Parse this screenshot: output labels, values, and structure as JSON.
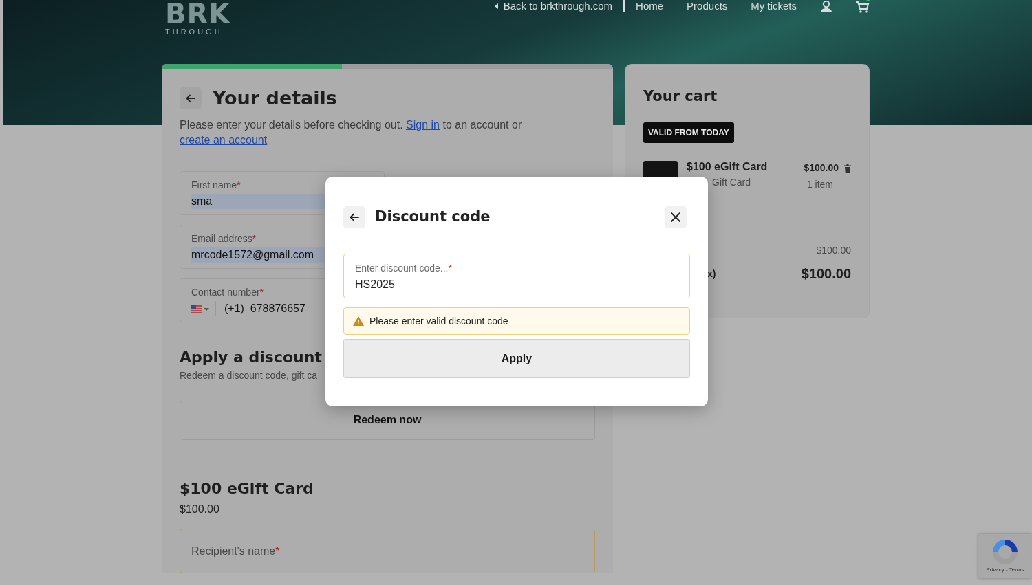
{
  "header": {
    "logo": {
      "text": "BRK",
      "subtext": "THROUGH"
    },
    "back_link": "Back to brkthrough.com",
    "nav": [
      {
        "label": "Home"
      },
      {
        "label": "Products"
      },
      {
        "label": "My tickets"
      }
    ]
  },
  "details": {
    "progress": {
      "level": 0.4
    },
    "title": "Your details",
    "intro": [
      {
        "kind": "text",
        "text": "Please enter your details before checking out. "
      },
      {
        "kind": "link",
        "text": "Sign in"
      },
      {
        "kind": "text",
        "text": " to an account or "
      },
      {
        "kind": "link",
        "text": "create an account"
      }
    ],
    "fields": [
      {
        "kind": "text",
        "label": "First name",
        "required_mark": "*",
        "value": "sma",
        "autofilled": true
      },
      {
        "kind": "text",
        "label": "Email address",
        "required_mark": "*",
        "value": "mrcode1572@gmail.com",
        "autofilled": true
      },
      {
        "kind": "phone",
        "label": "Contact number",
        "required_mark": "*",
        "prefix": "(+1)",
        "value": "678876657",
        "autofilled": false
      }
    ],
    "discount": {
      "title": "Apply a discount",
      "subtitle": "Redeem a discount code, gift ca",
      "button": "Redeem now"
    },
    "product": {
      "title": "$100 eGift Card",
      "price": "$100.00",
      "fields": [
        {
          "label": "Recipient's name",
          "required_mark": "*"
        }
      ]
    }
  },
  "cart": {
    "title": "Your cart",
    "badge": "VALID FROM TODAY",
    "items": [
      {
        "name": "$100 eGift Card",
        "subtitle": "Gift Card",
        "price": "$100.00",
        "quantity": "1 item"
      }
    ],
    "subtotal": "$100.00",
    "total_label": "x)",
    "total": "$100.00"
  },
  "modal": {
    "title": "Discount code",
    "field": {
      "label": "Enter discount code...",
      "required_mark": "*",
      "value": "HS2025"
    },
    "alert": "Please enter valid discount code",
    "button": "Apply"
  },
  "recaptcha": {
    "text": "Privacy - Terms"
  }
}
